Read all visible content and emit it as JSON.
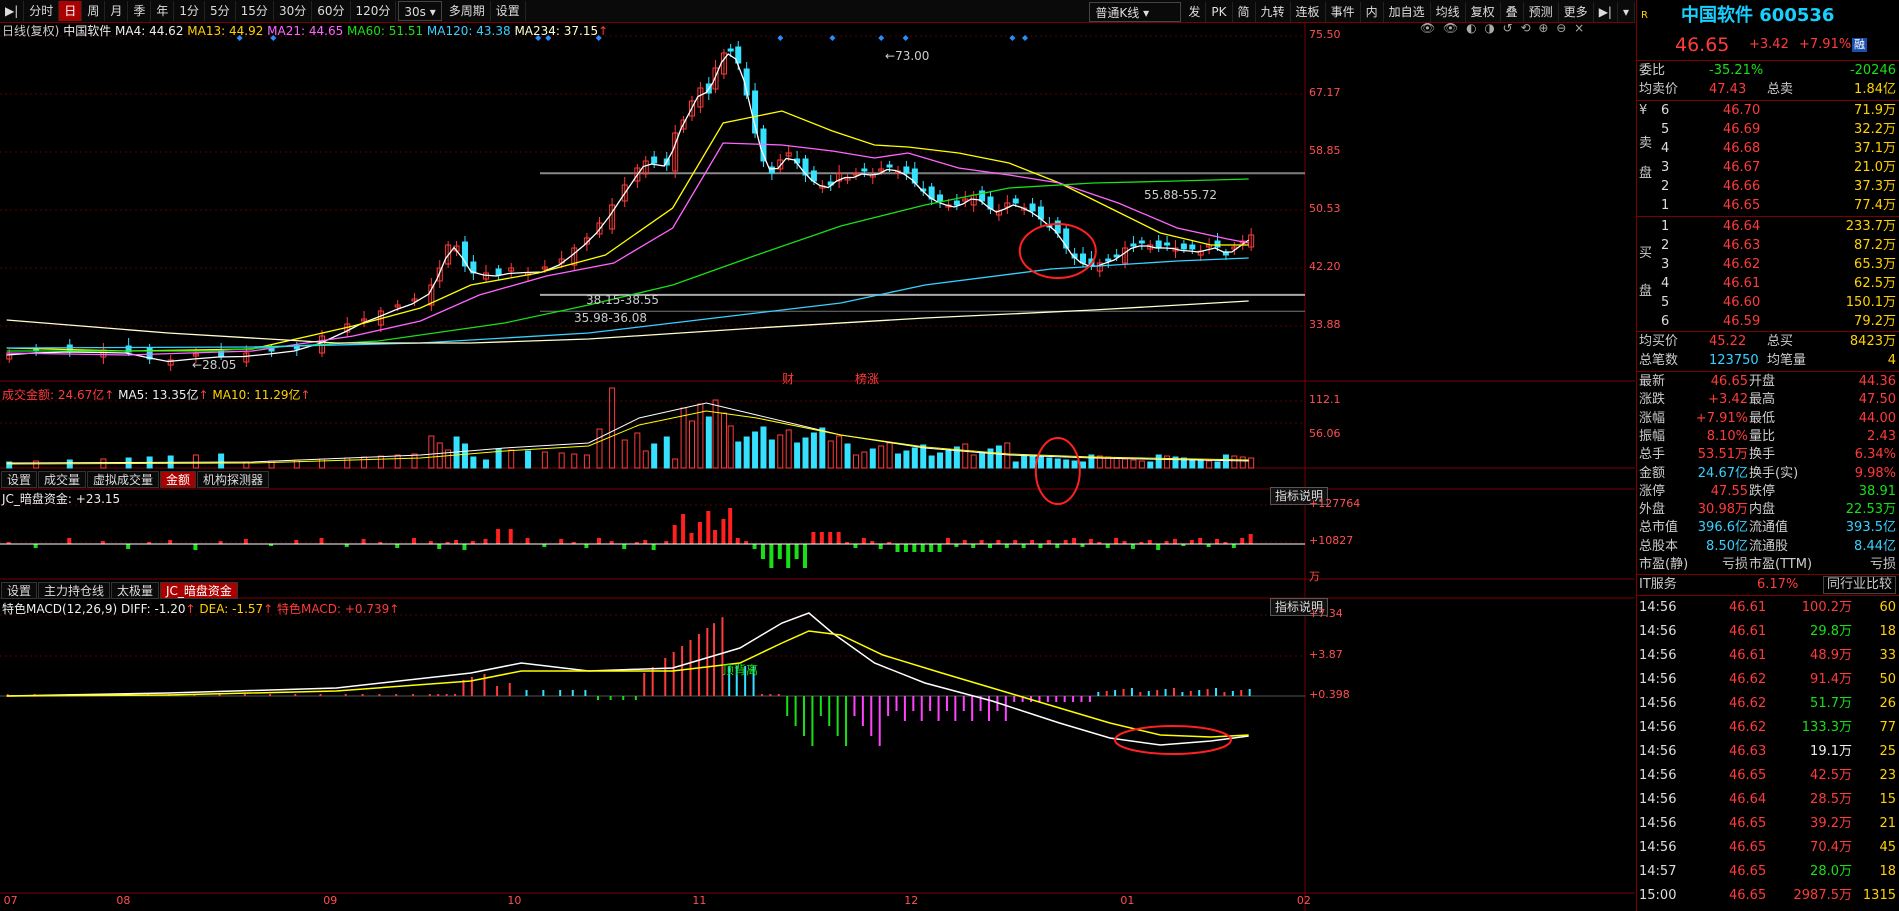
{
  "toolbar": {
    "items": [
      "分时",
      "日",
      "周",
      "月",
      "季",
      "年",
      "1分",
      "5分",
      "15分",
      "30分",
      "60分",
      "120分"
    ],
    "selected": "日",
    "period_dropdown": "30s",
    "multi": "多周期",
    "settings": "设置",
    "style_dropdown": "普通K线",
    "right_items": [
      "发",
      "PK",
      "简",
      "九转",
      "连板",
      "事件",
      "内",
      "加自选",
      "均线",
      "复权",
      "叠",
      "预测",
      "更多"
    ]
  },
  "kline": {
    "header": {
      "title": "日线(复权)",
      "name": "中国软件",
      "ma4": "MA4: 44.62",
      "ma13": "MA13: 44.92",
      "ma21": "MA21: 44.65",
      "ma60": "MA60: 51.51",
      "ma120": "MA120: 43.38",
      "ma234": "MA234: 37.15"
    },
    "y_ticks": [
      "75.50",
      "67.17",
      "58.85",
      "50.53",
      "42.20",
      "33.88"
    ],
    "annotations": {
      "high": "73.00",
      "low": "28.05",
      "range1": "55.88-55.72",
      "range2": "38.15-38.55",
      "range3": "35.98-36.08",
      "events": [
        "财",
        "榜涨"
      ]
    }
  },
  "volume": {
    "header": {
      "label": "成交金额: 24.67亿",
      "ma5": "MA5: 13.35亿",
      "ma10": "MA10: 11.29亿"
    },
    "y_ticks": [
      "112.1",
      "56.06"
    ]
  },
  "tabs1": [
    "设置",
    "成交量",
    "虚拟成交量",
    "金额",
    "机构探测器"
  ],
  "tabs1_selected": "金额",
  "jc": {
    "header": "JC_暗盘资金: +23.15",
    "y_ticks": [
      "+127764",
      "+10827",
      "万"
    ],
    "btn": "指标说明"
  },
  "tabs2": [
    "设置",
    "主力持仓线",
    "太极量",
    "JC_暗盘资金"
  ],
  "tabs2_selected": "JC_暗盘资金",
  "macd": {
    "header": {
      "name": "特色MACD(12,26,9)",
      "diff": "DIFF: -1.20",
      "dea": "DEA: -1.57",
      "macd": "特色MACD: +0.739"
    },
    "y_ticks": [
      "+7.34",
      "+3.87",
      "+0.398"
    ],
    "annotation": "顶背离",
    "btn": "指标说明"
  },
  "x_axis": [
    "07",
    "08",
    "09",
    "10",
    "11",
    "12",
    "01",
    "02"
  ],
  "right_panel": {
    "badge": "R",
    "title": "中国软件 600536",
    "price": "46.65",
    "change": "+3.42",
    "pct": "+7.91%",
    "tag": "融",
    "weibi": {
      "label": "委比",
      "v1": "-35.21%",
      "label2": "",
      "v2": "-20246"
    },
    "junmai": {
      "l1": "均卖价",
      "v1": "47.43",
      "l2": "总卖",
      "v2": "1.84亿"
    },
    "sell_label": "卖\n盘",
    "sell": [
      {
        "lv": "6",
        "p": "46.70",
        "v": "71.9万",
        "mark": "¥"
      },
      {
        "lv": "5",
        "p": "46.69",
        "v": "32.2万"
      },
      {
        "lv": "4",
        "p": "46.68",
        "v": "37.1万"
      },
      {
        "lv": "3",
        "p": "46.67",
        "v": "21.0万"
      },
      {
        "lv": "2",
        "p": "46.66",
        "v": "37.3万"
      },
      {
        "lv": "1",
        "p": "46.65",
        "v": "77.4万"
      }
    ],
    "buy": [
      {
        "lv": "1",
        "p": "46.64",
        "v": "233.7万"
      },
      {
        "lv": "2",
        "p": "46.63",
        "v": "87.2万"
      },
      {
        "lv": "3",
        "p": "46.62",
        "v": "65.3万"
      },
      {
        "lv": "4",
        "p": "46.61",
        "v": "62.5万"
      },
      {
        "lv": "5",
        "p": "46.60",
        "v": "150.1万"
      },
      {
        "lv": "6",
        "p": "46.59",
        "v": "79.2万"
      }
    ],
    "buy_label_top": "买",
    "buy_label_bot": "盘",
    "junmai2": {
      "l1": "均买价",
      "v1": "45.22",
      "l2": "总买",
      "v2": "8423万"
    },
    "zbs": {
      "l1": "总笔数",
      "v1": "123750",
      "l2": "均笔量",
      "v2": "4"
    },
    "stats": [
      {
        "l1": "最新",
        "v1": "46.65",
        "c1": "red",
        "l2": "开盘",
        "v2": "44.36",
        "c2": "red"
      },
      {
        "l1": "涨跌",
        "v1": "+3.42",
        "c1": "red",
        "l2": "最高",
        "v2": "47.50",
        "c2": "red"
      },
      {
        "l1": "涨幅",
        "v1": "+7.91%",
        "c1": "red",
        "l2": "最低",
        "v2": "44.00",
        "c2": "red"
      },
      {
        "l1": "振幅",
        "v1": "8.10%",
        "c1": "red",
        "l2": "量比",
        "v2": "2.43",
        "c2": "red"
      },
      {
        "l1": "总手",
        "v1": "53.51万",
        "c1": "red",
        "l2": "换手",
        "v2": "6.34%",
        "c2": "red"
      },
      {
        "l1": "金额",
        "v1": "24.67亿",
        "c1": "cy",
        "l2": "换手(实)",
        "v2": "9.98%",
        "c2": "red"
      },
      {
        "l1": "涨停",
        "v1": "47.55",
        "c1": "red",
        "l2": "跌停",
        "v2": "38.91",
        "c2": "grn"
      },
      {
        "l1": "外盘",
        "v1": "30.98万",
        "c1": "red",
        "l2": "内盘",
        "v2": "22.53万",
        "c2": "grn"
      },
      {
        "l1": "总市值",
        "v1": "396.6亿",
        "c1": "cy",
        "l2": "流通值",
        "v2": "393.5亿",
        "c2": "cy"
      },
      {
        "l1": "总股本",
        "v1": "8.50亿",
        "c1": "cy",
        "l2": "流通股",
        "v2": "8.44亿",
        "c2": "cy"
      },
      {
        "l1": "市盈(静)",
        "v1": "亏损",
        "c1": "gry",
        "l2": "市盈(TTM)",
        "v2": "亏损",
        "c2": "gry"
      }
    ],
    "industry": {
      "name": "IT服务",
      "pct": "6.17%",
      "btn": "同行业比较"
    },
    "ticks": [
      {
        "t": "14:56",
        "p": "46.61",
        "v": "100.2万",
        "n": "60",
        "c": "red"
      },
      {
        "t": "14:56",
        "p": "46.61",
        "v": "29.8万",
        "n": "18",
        "c": "grn"
      },
      {
        "t": "14:56",
        "p": "46.61",
        "v": "48.9万",
        "n": "33",
        "c": "red"
      },
      {
        "t": "14:56",
        "p": "46.62",
        "v": "91.4万",
        "n": "50",
        "c": "red"
      },
      {
        "t": "14:56",
        "p": "46.62",
        "v": "51.7万",
        "n": "26",
        "c": "grn"
      },
      {
        "t": "14:56",
        "p": "46.62",
        "v": "133.3万",
        "n": "77",
        "c": "grn"
      },
      {
        "t": "14:56",
        "p": "46.63",
        "v": "19.1万",
        "n": "25",
        "c": "wht"
      },
      {
        "t": "14:56",
        "p": "46.65",
        "v": "42.5万",
        "n": "23",
        "c": "red"
      },
      {
        "t": "14:56",
        "p": "46.64",
        "v": "28.5万",
        "n": "15",
        "c": "red"
      },
      {
        "t": "14:56",
        "p": "46.65",
        "v": "39.2万",
        "n": "21",
        "c": "red"
      },
      {
        "t": "14:56",
        "p": "46.65",
        "v": "70.4万",
        "n": "45",
        "c": "red"
      },
      {
        "t": "14:57",
        "p": "46.65",
        "v": "28.0万",
        "n": "18",
        "c": "grn"
      },
      {
        "t": "15:00",
        "p": "46.65",
        "v": "2987.5万",
        "n": "1315",
        "c": "red"
      }
    ]
  }
}
